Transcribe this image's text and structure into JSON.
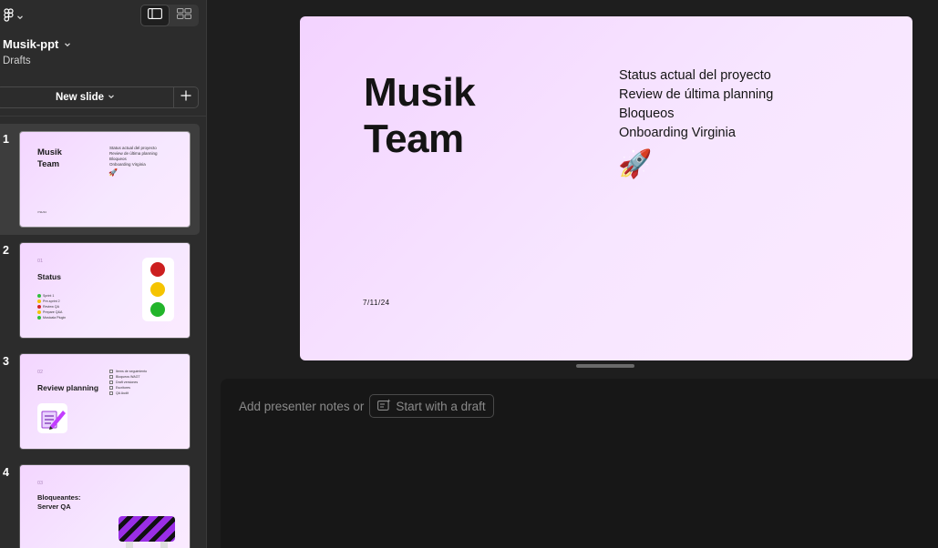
{
  "header": {
    "file_name": "Musik-ppt",
    "location": "Drafts",
    "new_slide_label": "New slide"
  },
  "slides": [
    {
      "number": "1",
      "title": "Musik\nTeam",
      "bullets": [
        "Status actual del proyecto",
        "Review de última planning",
        "Bloqueos",
        "Onboarding Virginia"
      ],
      "date": "7/11/24"
    },
    {
      "number": "2",
      "section_num": "01",
      "title": "Status",
      "status_rows": [
        {
          "label": "Sprint 1",
          "color": "#2dbf3c"
        },
        {
          "label": "Pre-sprint 2",
          "color": "#f2c200"
        },
        {
          "label": "Review QA",
          "color": "#d42525"
        },
        {
          "label": "Prepare Q&A",
          "color": "#f2c200"
        },
        {
          "label": "Musicala Plugin",
          "color": "#2dbf3c"
        }
      ]
    },
    {
      "number": "3",
      "section_num": "02",
      "title": "Review planning",
      "checklist": [
        "Items de seguimiento",
        "Bloqueos WAGT",
        "Draft versiones",
        "Escritores",
        "QA Audit"
      ]
    },
    {
      "number": "4",
      "section_num": "03",
      "title": "Bloqueantes:\nServer QA"
    }
  ],
  "current_slide": {
    "title_line1": "Musik",
    "title_line2": "Team",
    "bullets": [
      "Status actual del proyecto",
      "Review de última planning",
      "Bloqueos",
      "Onboarding Virginia"
    ],
    "emoji": "🚀",
    "date": "7/11/24"
  },
  "notes": {
    "placeholder": "Add presenter notes or",
    "draft_button": "Start with a draft"
  },
  "colors": {
    "sidebar_bg": "#2c2c2c",
    "canvas_bg": "#1e1e1e",
    "slide_gradient_start": "#f3d3ff",
    "slide_gradient_end": "#fbeaff"
  }
}
